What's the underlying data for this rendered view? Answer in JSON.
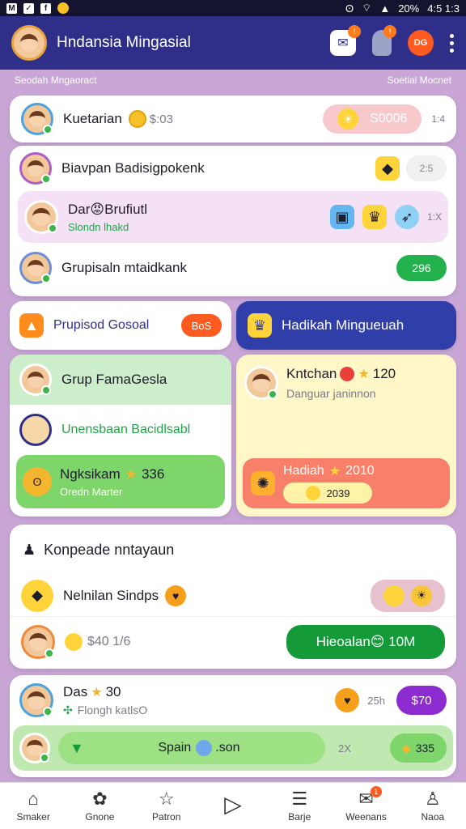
{
  "status": {
    "battery": "20%",
    "time": "4:5 1:3"
  },
  "header": {
    "title": "Hndansia Mingasial",
    "badge_1": "!",
    "badge_2": "!",
    "badge_3": "DG"
  },
  "subhead": {
    "left": "Seodah Mngaoract",
    "right": "Soetial Mocnet"
  },
  "feed": {
    "item1": {
      "name": "Kuetarian",
      "coins": "$:03",
      "pill": "S0006",
      "side": "1:4"
    },
    "item2": {
      "name": "Biаvpan Badisigpokenk",
      "side": "2:5"
    },
    "item3": {
      "name": "Dar😡Brufiutl",
      "sub": "Slondn lhakd",
      "side": "1:X"
    },
    "item4": {
      "name": "Grupisaln mtaidkank",
      "pill": "296"
    }
  },
  "promo": {
    "left_label": "Prupisod Gosoal",
    "left_badge": "BoS",
    "right_label": "Hadikah Mingueuah"
  },
  "groups": {
    "title": "Grup FamaGesla",
    "invite": "Unensbaan Bacidlsabl",
    "next": {
      "name": "Ngksikam",
      "score": "336",
      "sub": "Oredn Marter"
    },
    "rival": {
      "name": "Kntchan",
      "score": "120",
      "sub": "Danguar janinnon"
    },
    "reward": {
      "label": "Hadiah",
      "score": "2010",
      "pill": "2039"
    }
  },
  "compete": {
    "title": "Konpeade nntayaun",
    "row1": {
      "name": "Nelnilan Sindps"
    },
    "row2": {
      "value": "$40 1/6",
      "button": "Hieoalan😊 10M"
    }
  },
  "bottom": {
    "row1": {
      "name": "Das",
      "score": "30",
      "sub": "Flongh katlsO",
      "side": "25h",
      "pill": "$70"
    },
    "row2": {
      "label": "Spain",
      "suffix": ".son",
      "side": "2X",
      "pill": "335"
    }
  },
  "nav": [
    {
      "label": "Smaker"
    },
    {
      "label": "Gnone"
    },
    {
      "label": "Patron"
    },
    {
      "label": ""
    },
    {
      "label": "Barje"
    },
    {
      "label": "Weenans",
      "badge": "1"
    },
    {
      "label": "Naoa"
    }
  ],
  "colors": {
    "header": "#2f2f8a",
    "accent_green": "#22b14c",
    "accent_orange": "#ff5a1f",
    "accent_purple": "#8c2bd0"
  }
}
